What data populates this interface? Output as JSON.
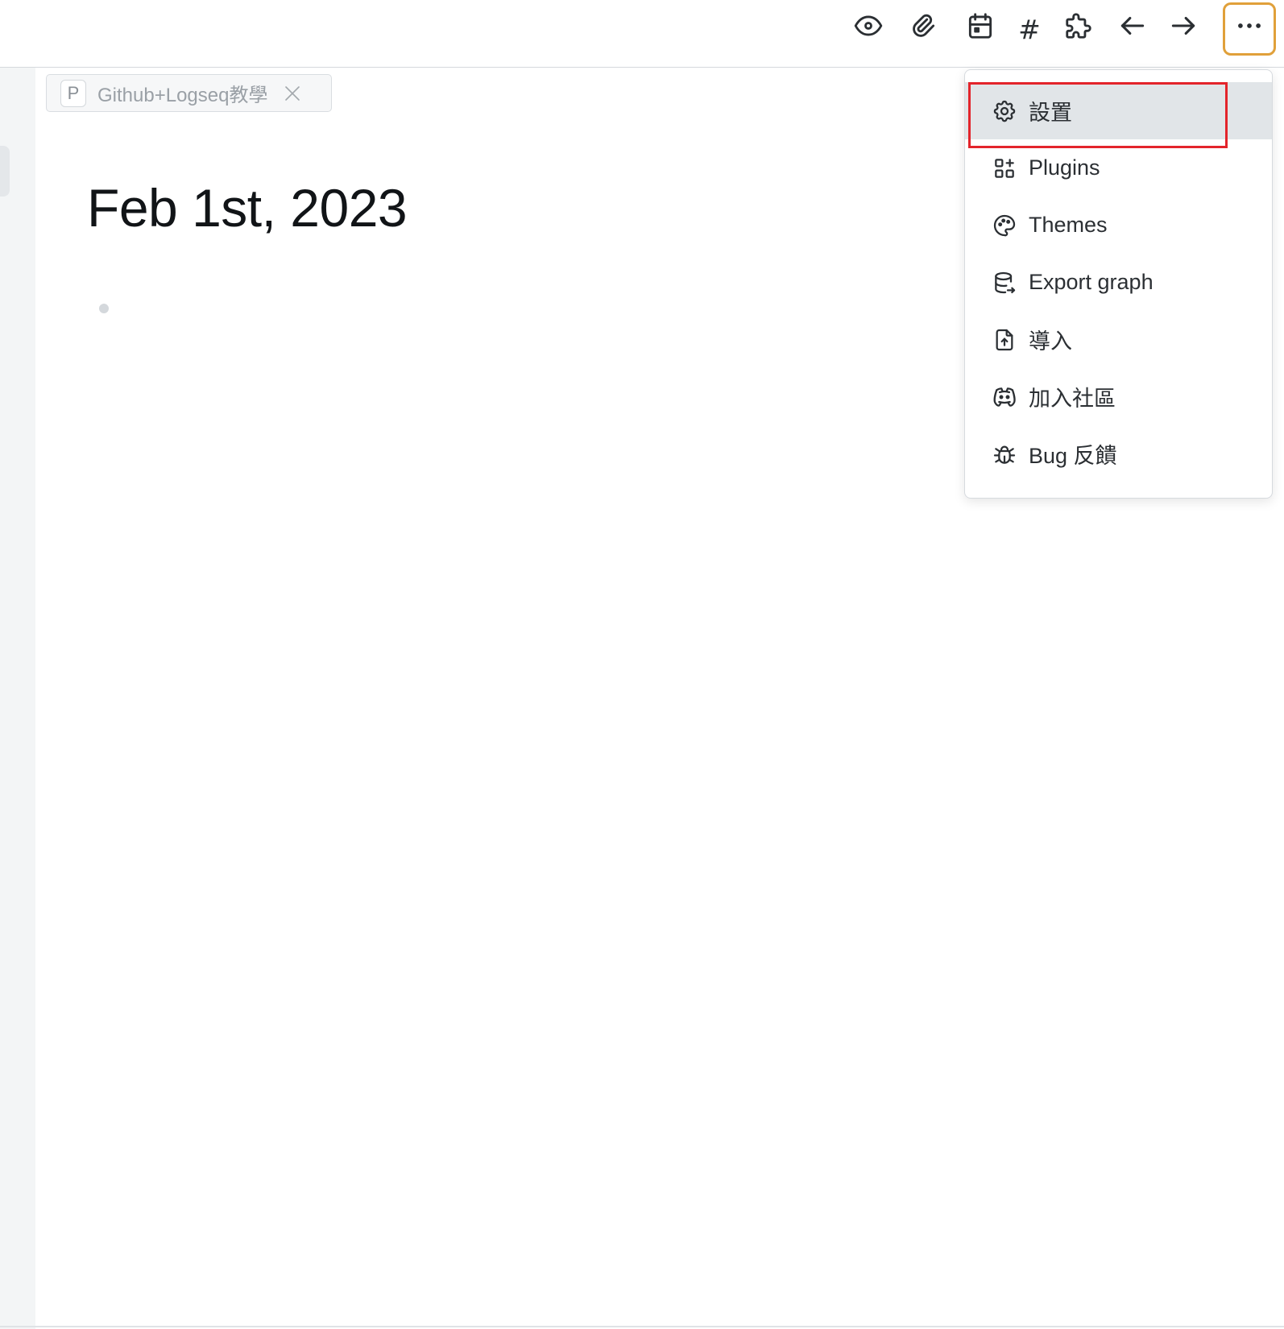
{
  "header": {
    "icons": [
      {
        "name": "eye-icon",
        "glyph": "eye"
      },
      {
        "name": "attachment-icon",
        "glyph": "paperclip"
      },
      {
        "name": "calendar-icon",
        "glyph": "calendar"
      },
      {
        "name": "hash-icon",
        "glyph": "#"
      },
      {
        "name": "puzzle-icon",
        "glyph": "puzzle"
      },
      {
        "name": "arrow-left-icon",
        "glyph": "arrow-left"
      },
      {
        "name": "arrow-right-icon",
        "glyph": "arrow-right"
      },
      {
        "name": "more-icon",
        "glyph": "ellipsis"
      }
    ],
    "hash_label": "#",
    "active_button": "more",
    "active_color": "#e0a03a"
  },
  "tab": {
    "letter": "P",
    "title": "Github+Logseq教學"
  },
  "page": {
    "title": "Feb 1st, 2023"
  },
  "menu": {
    "items": [
      {
        "label": "設置",
        "icon": "gear-icon",
        "highlighted": true
      },
      {
        "label": "Plugins",
        "icon": "plugins-grid-icon"
      },
      {
        "label": "Themes",
        "icon": "palette-icon"
      },
      {
        "label": "Export graph",
        "icon": "database-export-icon"
      },
      {
        "label": "導入",
        "icon": "file-upload-icon"
      },
      {
        "label": "加入社區",
        "icon": "discord-icon"
      },
      {
        "label": "Bug 反饋",
        "icon": "bug-icon"
      }
    ],
    "callout_color": "#e3242b",
    "highlight_color": "#e1e5e8"
  }
}
